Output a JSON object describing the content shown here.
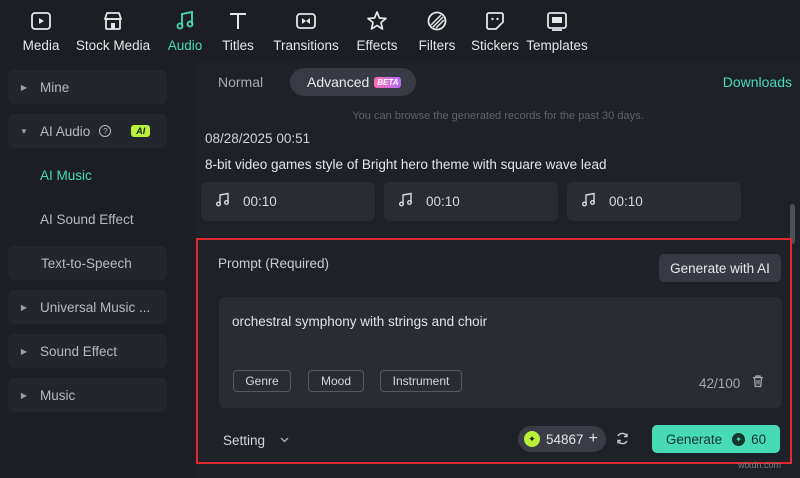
{
  "toolbar": {
    "items": [
      {
        "label": "Media",
        "icon": "media-icon"
      },
      {
        "label": "Stock Media",
        "icon": "stock-media-icon"
      },
      {
        "label": "Audio",
        "icon": "audio-note-icon",
        "active": true
      },
      {
        "label": "Titles",
        "icon": "titles-t-icon"
      },
      {
        "label": "Transitions",
        "icon": "transitions-icon"
      },
      {
        "label": "Effects",
        "icon": "effects-star-icon"
      },
      {
        "label": "Filters",
        "icon": "filters-icon"
      },
      {
        "label": "Stickers",
        "icon": "stickers-icon"
      },
      {
        "label": "Templates",
        "icon": "templates-icon"
      }
    ]
  },
  "sidebar": {
    "mine": "Mine",
    "ai_audio": "AI Audio",
    "ai_badge": "AI",
    "ai_music": "AI Music",
    "ai_sound_effect": "AI Sound Effect",
    "text_to_speech": "Text-to-Speech",
    "universal_music": "Universal Music ...",
    "sound_effect": "Sound Effect",
    "music": "Music"
  },
  "tabs": {
    "normal": "Normal",
    "advanced": "Advanced",
    "beta": "BETA",
    "downloads": "Downloads"
  },
  "notice": "You can browse the generated records for the past 30 days.",
  "record": {
    "date": "08/28/2025 00:51",
    "prompt": "8-bit video games style of Bright hero theme with square wave lead",
    "clips": [
      {
        "duration": "00:10"
      },
      {
        "duration": "00:10"
      },
      {
        "duration": "00:10"
      }
    ]
  },
  "prompt_panel": {
    "label": "Prompt (Required)",
    "generate_with_ai": "Generate with AI",
    "text": "orchestral symphony with strings and choir",
    "chips": [
      "Genre",
      "Mood",
      "Instrument"
    ],
    "count": "42/100",
    "setting": "Setting",
    "credits": "54867",
    "generate": "Generate",
    "cost": "60"
  },
  "watermark": "wtxdn.com",
  "colors": {
    "accent": "#44dbb6",
    "highlight_border": "#e12a2f",
    "credit_coin": "#b8f03a"
  }
}
